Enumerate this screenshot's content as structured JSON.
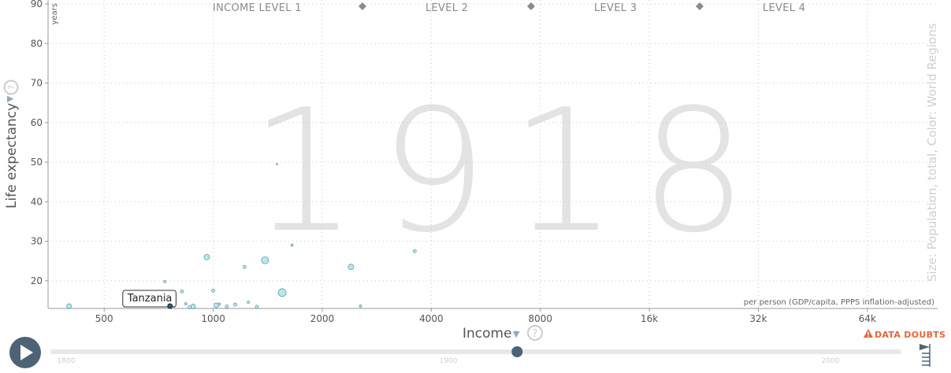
{
  "chart_data": {
    "type": "scatter",
    "year_label": "1918",
    "xlabel": "Income",
    "ylabel": "Life expectancy",
    "x_scale": "log",
    "xlim": [
      350,
      100000
    ],
    "ylim": [
      13,
      91
    ],
    "x_ticks": [
      500,
      1000,
      2000,
      4000,
      8000,
      16000,
      32000,
      64000
    ],
    "x_tick_labels": [
      "500",
      "1000",
      "2000",
      "4000",
      "8000",
      "16k",
      "32k",
      "64k"
    ],
    "y_ticks": [
      20,
      30,
      40,
      50,
      60,
      70,
      80,
      90
    ],
    "y_unit": "years",
    "x_note": "per person (GDP/capita, PPPS inflation-adjusted)",
    "size_color_note": "Size: Population, total, Color: World Regions",
    "income_levels": [
      "INCOME LEVEL 1",
      "LEVEL 2",
      "LEVEL 3",
      "LEVEL 4"
    ],
    "highlight": {
      "label": "Tanzania",
      "x": 760,
      "y": 13.5
    },
    "points": [
      {
        "x": 960,
        "y": 26,
        "r": 3.5
      },
      {
        "x": 1390,
        "y": 25.2,
        "r": 4.5
      },
      {
        "x": 1550,
        "y": 17,
        "r": 5
      },
      {
        "x": 2400,
        "y": 23.5,
        "r": 3.5
      },
      {
        "x": 1220,
        "y": 23.5,
        "r": 2
      },
      {
        "x": 3600,
        "y": 27.5,
        "r": 2
      },
      {
        "x": 1650,
        "y": 29,
        "r": 1.5
      },
      {
        "x": 1500,
        "y": 49.5,
        "r": 1
      },
      {
        "x": 1000,
        "y": 17.5,
        "r": 2
      },
      {
        "x": 820,
        "y": 17.3,
        "r": 2
      },
      {
        "x": 735,
        "y": 19.8,
        "r": 1.5
      },
      {
        "x": 1150,
        "y": 14,
        "r": 2
      },
      {
        "x": 880,
        "y": 13.5,
        "r": 3
      },
      {
        "x": 840,
        "y": 14.2,
        "r": 1.5
      },
      {
        "x": 1020,
        "y": 13.8,
        "r": 3
      },
      {
        "x": 1090,
        "y": 13.5,
        "r": 2
      },
      {
        "x": 1320,
        "y": 13.4,
        "r": 2
      },
      {
        "x": 2550,
        "y": 13.6,
        "r": 1.5
      },
      {
        "x": 780,
        "y": 13.6,
        "r": 1.5
      },
      {
        "x": 400,
        "y": 13.6,
        "r": 3
      },
      {
        "x": 860,
        "y": 13.3,
        "r": 2
      },
      {
        "x": 1250,
        "y": 14.6,
        "r": 1.5
      },
      {
        "x": 1040,
        "y": 14.1,
        "r": 1.5
      }
    ]
  },
  "controls": {
    "xaxis_title": "Income",
    "yaxis_title": "Life expectancy",
    "y_unit": "years",
    "data_doubts": "DATA DOUBTS",
    "timeline": {
      "labels": [
        "1800",
        "1900",
        "2000"
      ],
      "start": 1800,
      "end": 2018,
      "current": 1918
    }
  }
}
